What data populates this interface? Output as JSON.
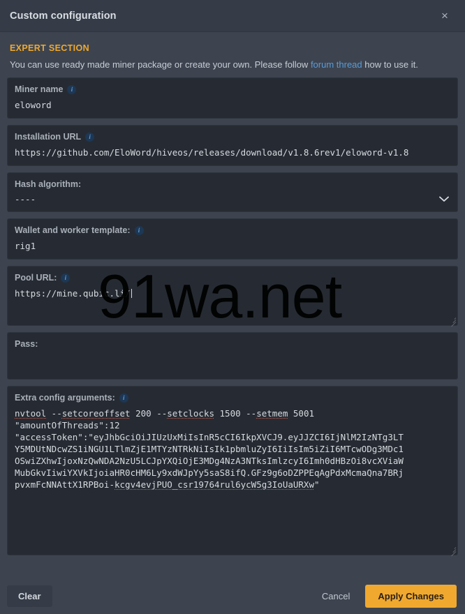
{
  "window": {
    "title": "Custom configuration",
    "close_label": "×"
  },
  "notice": {
    "expert_label": "EXPERT SECTION",
    "intro_prefix": "You can use ready made miner package or create your own. Please follow ",
    "intro_link": "forum thread",
    "intro_suffix": " how to use it."
  },
  "fields": {
    "miner_name": {
      "label": "Miner name",
      "info": "i",
      "value": "eloword"
    },
    "installation_url": {
      "label": "Installation URL",
      "info": "i",
      "value": "https://github.com/EloWord/hiveos/releases/download/v1.8.6rev1/eloword-v1.8"
    },
    "hash_algorithm": {
      "label": "Hash algorithm:",
      "value": "----",
      "chevron": "⌄"
    },
    "wallet_template": {
      "label": "Wallet and worker template:",
      "info": "i",
      "value": "rig1"
    },
    "pool_url": {
      "label": "Pool URL:",
      "info": "i",
      "value": "https://mine.qubic.li/"
    },
    "pass": {
      "label": "Pass:",
      "value": ""
    },
    "extra_config": {
      "label": "Extra config arguments:",
      "info": "i",
      "lines": [
        "nvtool --setcoreoffset 200 --setclocks 1500 --setmem 5001",
        "\"amountOfThreads\":12",
        "\"accessToken\":\"eyJhbGciOiJIUzUxMiIsInR5cCI6IkpXVCJ9.eyJJZCI6IjNlM2IzNTg3LT",
        "Y5MDUtNDcwZS1iNGU1LTlmZjE1MTYzNTRkNiIsIk1pbmluZyI6IiIsIm5iZiI6MTcwODg3MDc1",
        "OSwiZXhwIjoxNzQwNDA2NzU5LCJpYXQiOjE3MDg4NzA3NTksImlzcyI6Imh0dHBzOi8vcXViaW",
        "MubGkvIiwiYXVkIjoiaHR0cHM6Ly9xdWJpYy5saS8ifQ.GFz9g6oDZPPEqAgPdxMcmaQna7BRj",
        "pvxmFcNNAttX1RPBoi-kcgv4evjPUO_csr19764rul6ycW5g3IoUaURXw\""
      ]
    }
  },
  "footer": {
    "clear_label": "Clear",
    "cancel_label": "Cancel",
    "apply_label": "Apply Changes"
  },
  "watermark": {
    "text": "91wa.net"
  },
  "colors": {
    "accent": "#f0a92e",
    "link": "#5b9bd5",
    "panel": "#3d4450",
    "field": "#262b33",
    "spellcheck": "#d05a4a"
  }
}
